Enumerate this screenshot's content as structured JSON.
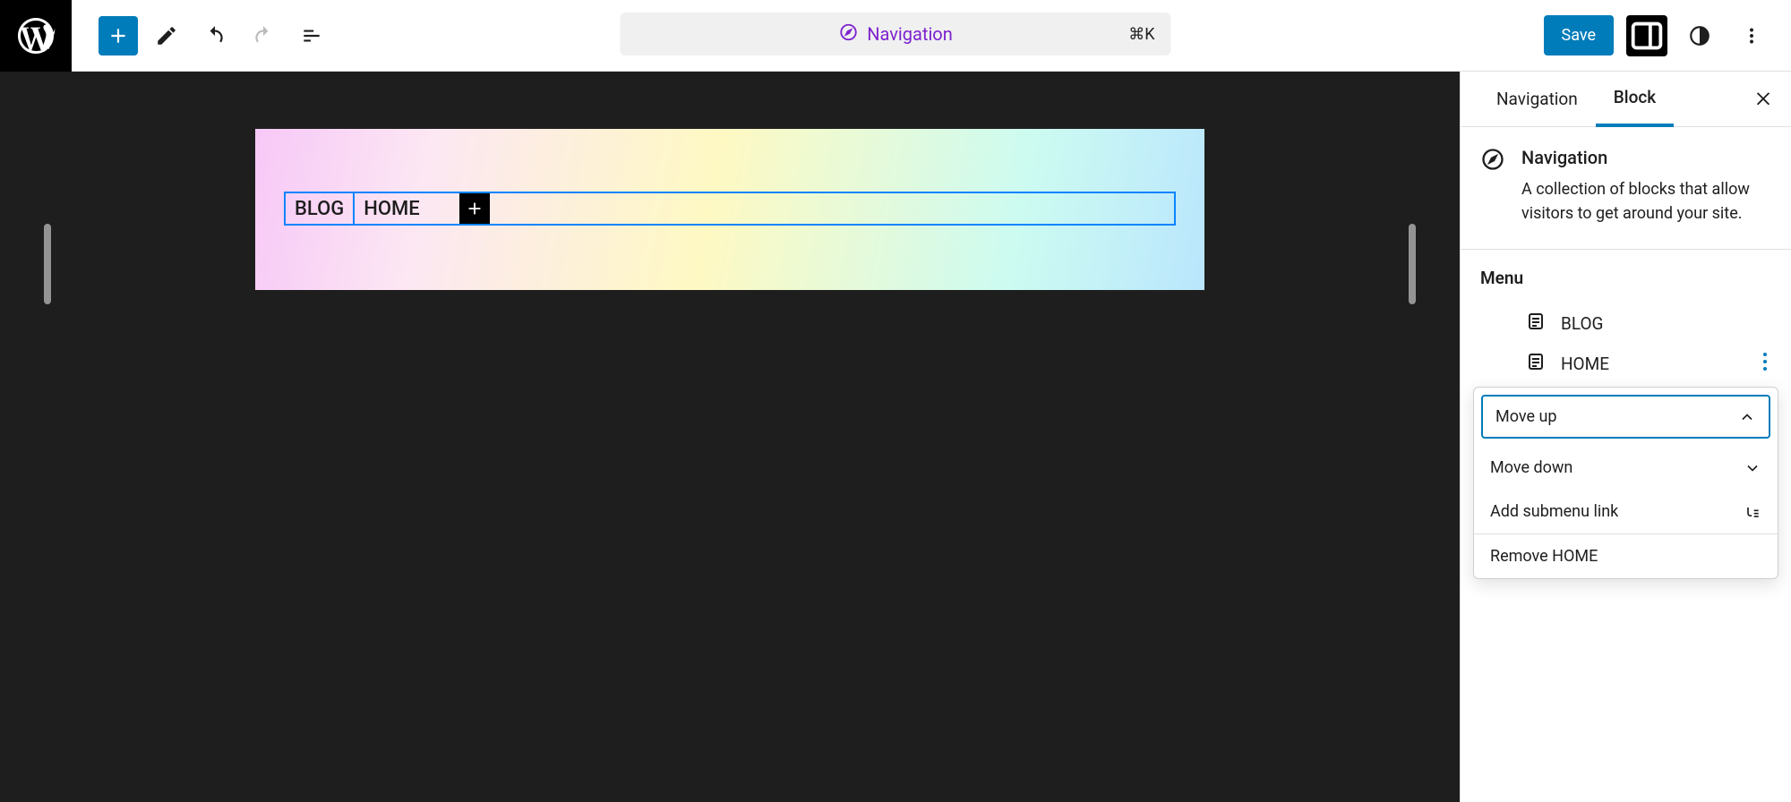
{
  "toolbar": {
    "command_label": "Navigation",
    "command_shortcut": "⌘K",
    "save_label": "Save"
  },
  "nav_block": {
    "items": [
      "BLOG",
      "HOME"
    ]
  },
  "sidebar": {
    "tabs": {
      "inactive": "Navigation",
      "active": "Block"
    },
    "block_info": {
      "title": "Navigation",
      "description": "A collection of blocks that allow visitors to get around your site."
    },
    "menu": {
      "title": "Menu",
      "items": [
        "BLOG",
        "HOME"
      ]
    },
    "dropdown": {
      "move_up": "Move up",
      "move_down": "Move down",
      "add_submenu": "Add submenu link",
      "remove": "Remove HOME"
    }
  }
}
